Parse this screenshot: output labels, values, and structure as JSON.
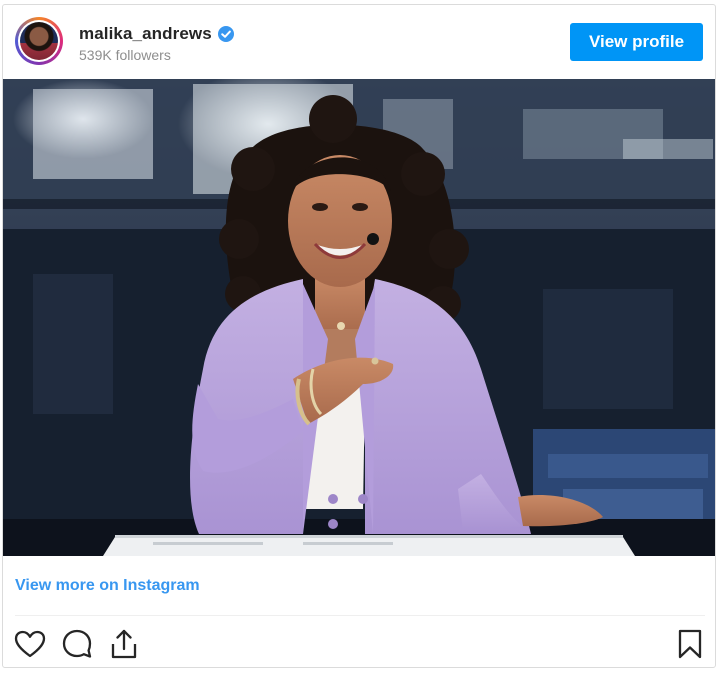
{
  "post": {
    "username": "malika_andrews",
    "verified": true,
    "followers": "539K followers",
    "view_profile_label": "View profile",
    "view_more_label": "View more on Instagram"
  },
  "icons": {
    "verified": "verified-badge-icon",
    "like": "heart-icon",
    "comment": "comment-icon",
    "share": "share-icon",
    "save": "bookmark-icon"
  },
  "colors": {
    "accent_blue": "#0095f6",
    "link_blue": "#3897f0",
    "username": "#262626",
    "secondary_text": "#8e8e8e",
    "blazer_lavender": "#b8a3dc"
  }
}
